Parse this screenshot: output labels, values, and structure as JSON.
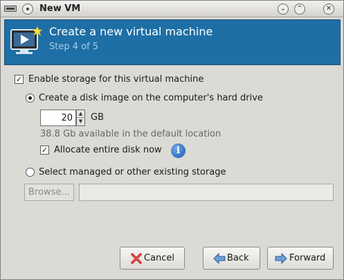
{
  "window": {
    "title": "New VM"
  },
  "header": {
    "title": "Create a new virtual machine",
    "step": "Step 4 of 5"
  },
  "storage": {
    "enable_label": "Enable storage for this virtual machine",
    "enable_checked": true,
    "create_disk_label": "Create a disk image on the computer's hard drive",
    "create_disk_selected": true,
    "size_value": "20",
    "size_unit": "GB",
    "available_text": "38.8 Gb available in the default location",
    "allocate_label": "Allocate entire disk now",
    "allocate_checked": true,
    "managed_label": "Select managed or other existing storage",
    "managed_selected": false,
    "browse_label": "Browse...",
    "path_value": ""
  },
  "buttons": {
    "cancel": "Cancel",
    "back": "Back",
    "forward": "Forward"
  },
  "icons": {
    "window_menu": "window-menu-icon",
    "vm_header": "monitor-play-icon",
    "info": "info-icon",
    "cancel": "red-x-icon",
    "back": "left-arrow-icon",
    "forward": "right-arrow-icon"
  },
  "colors": {
    "header_bg": "#1e6fa6",
    "header_subtitle": "#a8cde8",
    "window_bg": "#dcdad5"
  }
}
